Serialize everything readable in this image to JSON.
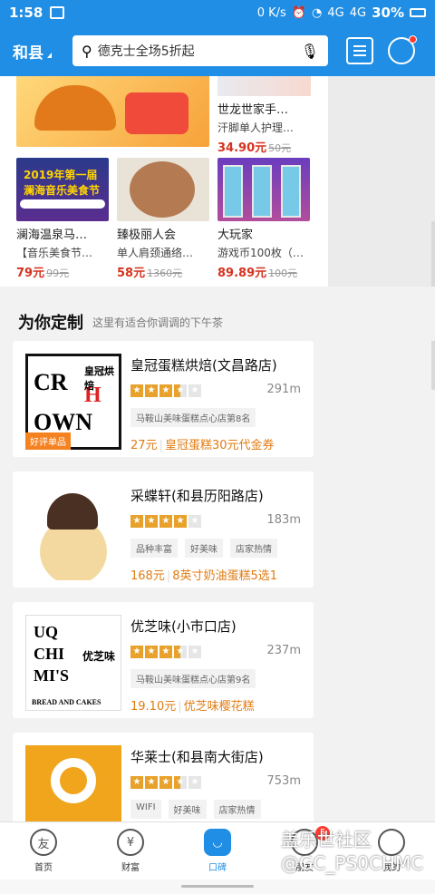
{
  "status_bar": {
    "time": "1:58",
    "net": "0 K/s",
    "sig1": "4G",
    "sig2": "4G",
    "battery": "30%"
  },
  "header": {
    "city": "和县",
    "search_placeholder": "德克士全场5折起"
  },
  "top_products": [
    {
      "title": "世龙世家手…",
      "subtitle": "汗脚单人护理…",
      "price": "34.90元",
      "old_price": "50元"
    },
    {
      "title": "澜海温泉马…",
      "subtitle": "【音乐美食节…",
      "price": "79元",
      "old_price": "99元",
      "banner_text": "2019年第一届 澜海音乐美食节"
    },
    {
      "title": "臻极丽人会",
      "subtitle": "单人肩颈通络…",
      "price": "58元",
      "old_price": "1360元"
    },
    {
      "title": "大玩家",
      "subtitle": "游戏币100枚（…",
      "price": "89.89元",
      "old_price": "100元"
    }
  ],
  "section": {
    "title": "为你定制",
    "subtitle": "这里有适合你调调的下午茶"
  },
  "shops": [
    {
      "name": "皇冠蛋糕烘焙(文昌路店)",
      "rating": 3.5,
      "distance": "291m",
      "tags": [
        "马鞍山美味蛋糕点心店第8名"
      ],
      "deal_price": "27元",
      "deal_text": "皇冠蛋糕30元代金券",
      "badge": "好评单品",
      "logo_top": "CR",
      "logo_bottom": "OWN",
      "logo_h": "H",
      "logo_cn": "皇冠烘焙"
    },
    {
      "name": "采蝶轩(和县历阳路店)",
      "rating": 4,
      "distance": "183m",
      "tags": [
        "品种丰富",
        "好美味",
        "店家热情"
      ],
      "deal_price": "168元",
      "deal_text": "8英寸奶油蛋糕5选1"
    },
    {
      "name": "优芝味(小市口店)",
      "rating": 3.5,
      "distance": "237m",
      "tags": [
        "马鞍山美味蛋糕点心店第9名"
      ],
      "deal_price": "19.10元",
      "deal_text": "优芝味樱花糕",
      "logo_l1": "UQ",
      "logo_l2": "CHI",
      "logo_l3": "MI'S",
      "logo_cn": "优芝味",
      "logo_bottom": "BREAD AND CAKES"
    },
    {
      "name": "华莱士(和县南大街店)",
      "rating": 3.5,
      "distance": "753m",
      "tags": [
        "WIFI",
        "好美味",
        "店家热情"
      ]
    }
  ],
  "bottom_nav": [
    {
      "label": "首页",
      "icon_text": "友",
      "active": false
    },
    {
      "label": "财富",
      "icon_text": "¥",
      "active": false
    },
    {
      "label": "口碑",
      "icon_text": "◡",
      "active": true
    },
    {
      "label": "朋友",
      "icon_text": "",
      "active": false,
      "badge": "5"
    },
    {
      "label": "我的",
      "icon_text": "",
      "active": false
    }
  ],
  "watermark": {
    "line1": "盖乐世社区",
    "line2": "@GC_PS0CHMC"
  }
}
